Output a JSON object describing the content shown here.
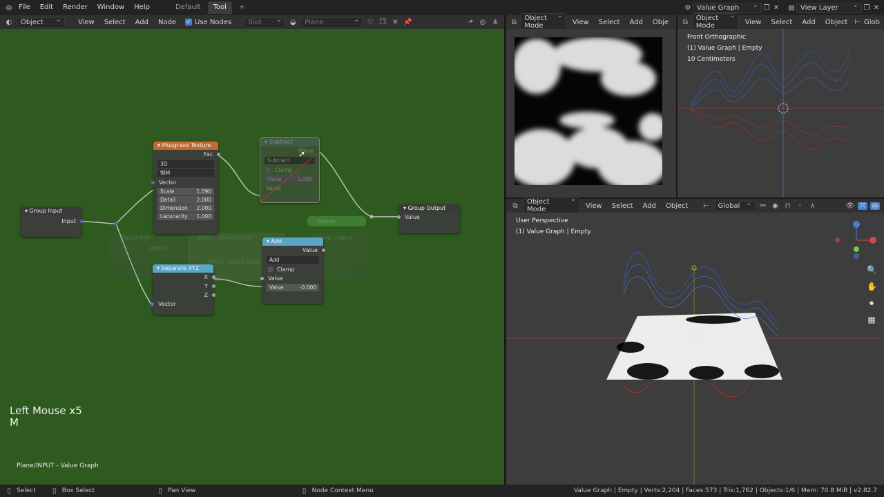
{
  "topbar": {
    "menus": [
      "File",
      "Edit",
      "Render",
      "Window",
      "Help"
    ],
    "workspace_tabs": [
      "Default",
      "Tool"
    ],
    "active_tab": "Tool",
    "add_tab": "+",
    "scene_name": "Value Graph",
    "view_layer": "View Layer"
  },
  "node_editor": {
    "header": {
      "mode": "Object",
      "menus": [
        "View",
        "Select",
        "Add",
        "Node"
      ],
      "use_nodes_label": "Use Nodes",
      "slot": "Slot",
      "object_name": "Plane"
    },
    "overlay_text": {
      "line1": "Left Mouse x5",
      "line2": "M"
    },
    "path_label": "Plane/INPUT - Value Graph",
    "nodes": {
      "musgrave": {
        "title": "Musgrave Texture",
        "output": "Fac",
        "dim_mode": "3D",
        "type": "fBM",
        "vector_label": "Vector",
        "fields": [
          {
            "label": "Scale",
            "value": "1.090"
          },
          {
            "label": "Detail",
            "value": "2.000"
          },
          {
            "label": "Dimension",
            "value": "2.000"
          },
          {
            "label": "Lacunarity",
            "value": "1.000"
          }
        ]
      },
      "subtract": {
        "title": "Subtract",
        "output": "Value",
        "operation": "Subtract",
        "clamp": "Clamp",
        "value_label": "Value",
        "value": "1.000",
        "input": "Value"
      },
      "group_input": {
        "title": "Group Input",
        "output": "Input"
      },
      "group_output": {
        "title": "Group Output",
        "input": "Value"
      },
      "separate": {
        "title": "Separate XYZ",
        "x": "X",
        "y": "Y",
        "z": "Z",
        "input": "Vector"
      },
      "add": {
        "title": "Add",
        "output": "Value",
        "operation": "Add",
        "clamp": "Clamp",
        "input": "Value",
        "value_label": "Value",
        "value": "-0.000"
      },
      "ghost": {
        "t1": "Object Info",
        "t2": "INPUT - Value Graph",
        "t3": "Group Output",
        "t4": "Object",
        "t5": "INPUT - Value Graph",
        "t6": "Viewer"
      }
    }
  },
  "image_editor": {
    "header_menus": [
      "View",
      "Select",
      "Add",
      "Obje"
    ],
    "mode": "Object Mode"
  },
  "viewport_front": {
    "mode": "Object Mode",
    "menus": [
      "View",
      "Select",
      "Add",
      "Object"
    ],
    "glob": "Glob",
    "info": [
      "Front Orthographic",
      "(1) Value Graph | Empty",
      "10 Centimeters"
    ]
  },
  "viewport_persp": {
    "mode": "Object Mode",
    "menus": [
      "View",
      "Select",
      "Add",
      "Object"
    ],
    "orientation": "Global",
    "info": [
      "User Perspective",
      "(1) Value Graph | Empty"
    ]
  },
  "statusbar": {
    "items": [
      "Select",
      "Box Select",
      "Pan View",
      "Node Context Menu"
    ],
    "stats": "Value Graph | Empty | Verts:2,204 | Faces:573 | Tris:1,762 | Objects:1/6 | Mem: 70.8 MiB | v2.82.7"
  },
  "colors": {
    "node_bg": "#2f5a1f",
    "musgrave": "#c46a2d",
    "converter": "#5aa6c8",
    "group": "#3a3a3a"
  }
}
